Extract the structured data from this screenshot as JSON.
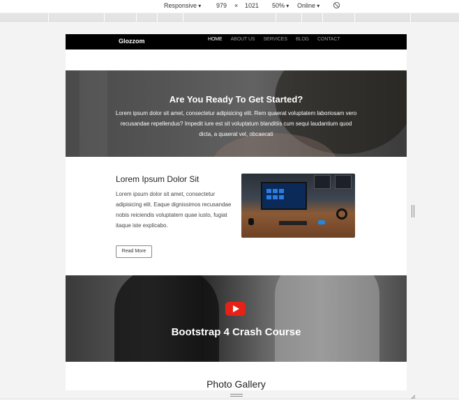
{
  "devtools": {
    "device": "Responsive",
    "width": "979",
    "times": "×",
    "height": "1021",
    "zoom": "50%",
    "network": "Online",
    "rotate_icon": "rotate-icon"
  },
  "site": {
    "brand": "Glozzom",
    "nav": [
      "HOME",
      "ABOUT US",
      "SERVICES",
      "BLOG",
      "CONTACT"
    ],
    "hero": {
      "title": "Are You Ready To Get Started?",
      "text": "Lorem ipsum dolor sit amet, consectetur adipisicing elit. Rem quaerat voluptatem laboriosam vero recusandae repellendus? Impedit iure est sit voluptatum blanditiis cum sequi laudantium quod dicta, a quaerat vel, obcaecati"
    },
    "info": {
      "title": "Lorem Ipsum Dolor Sit",
      "text": "Lorem ipsum dolor sit amet, consectetur adipisicing elit. Eaque dignissimos recusandae nobis reiciendis voluptatem quae iusto, fugiat itaque iste explicabo.",
      "button": "Read More"
    },
    "video": {
      "title": "Bootstrap 4 Crash Course",
      "play_icon": "youtube-play-icon"
    },
    "gallery": {
      "title": "Photo Gallery"
    }
  }
}
